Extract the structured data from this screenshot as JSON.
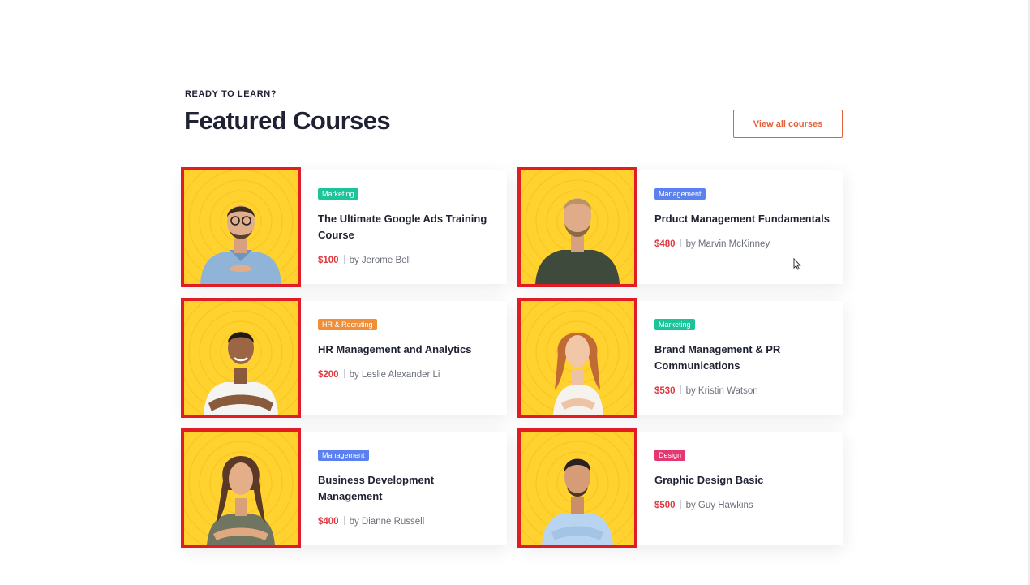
{
  "section": {
    "eyebrow": "READY TO LEARN?",
    "title": "Featured Courses",
    "view_all_label": "View all courses"
  },
  "colors": {
    "accent": "#e5613c",
    "price": "#e2383f",
    "thumb_bg": "#ffd22f",
    "thumb_border": "#e21c24"
  },
  "courses": [
    {
      "tag": "Marketing",
      "tag_color": "#1dc49a",
      "title": "The Ultimate Google Ads Training Course",
      "price": "$100",
      "author": "by Jerome Bell",
      "photo": "man-glasses-blue-shirt"
    },
    {
      "tag": "Management",
      "tag_color": "#5b80f0",
      "title": "Prduct Management Fundamentals",
      "price": "$480",
      "author": "by Marvin McKinney",
      "photo": "man-beard-green-sweater"
    },
    {
      "tag": "HR & Recruting",
      "tag_color": "#f08f3a",
      "title": "HR  Management and Analytics",
      "price": "$200",
      "author": "by Leslie Alexander Li",
      "photo": "man-white-polo"
    },
    {
      "tag": "Marketing",
      "tag_color": "#1dc49a",
      "title": "Brand Management & PR Communications",
      "price": "$530",
      "author": "by Kristin Watson",
      "photo": "woman-red-hair"
    },
    {
      "tag": "Management",
      "tag_color": "#5b80f0",
      "title": "Business Development Management",
      "price": "$400",
      "author": "by Dianne Russell",
      "photo": "woman-long-hair-olive-top"
    },
    {
      "tag": "Design",
      "tag_color": "#e53872",
      "title": "Graphic Design Basic",
      "price": "$500",
      "author": "by Guy Hawkins",
      "photo": "man-light-blue-shirt"
    }
  ]
}
